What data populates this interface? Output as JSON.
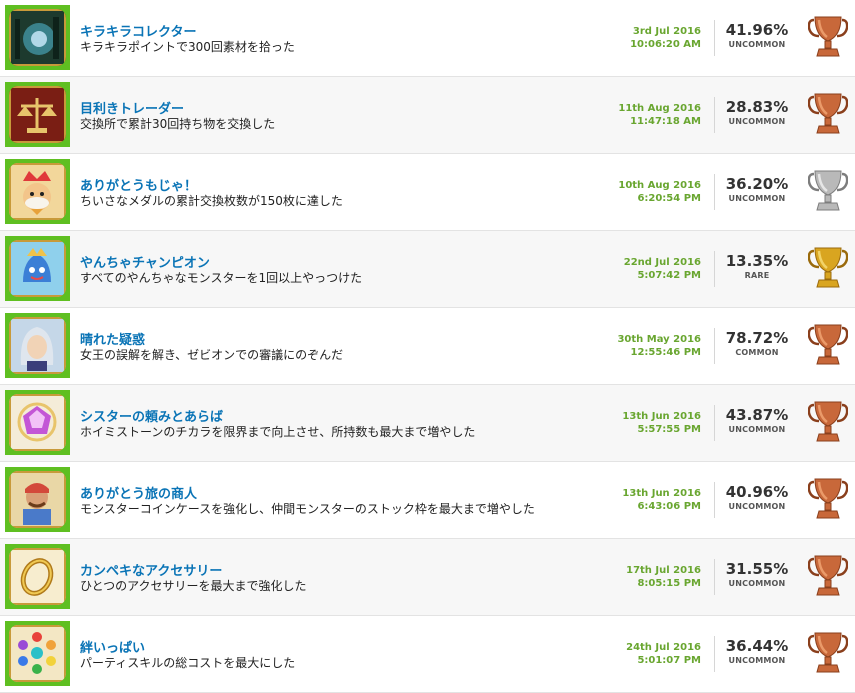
{
  "colors": {
    "accent_green": "#5fbf21",
    "title_blue": "#0a74b6",
    "date_green": "#69a630",
    "bronze": "#c8683a",
    "silver": "#b9b9b9",
    "gold": "#d9a520"
  },
  "trophies": [
    {
      "title": "キラキラコレクター",
      "description": "キラキラポイントで300回素材を拾った",
      "date": "3rd Jul 2016",
      "time": "10:06:20 AM",
      "percent": "41.96%",
      "rarity": "UNCOMMON",
      "trophy_type": "bronze",
      "icon": "glowing-forest-icon"
    },
    {
      "title": "目利きトレーダー",
      "description": "交換所で累計30回持ち物を交換した",
      "date": "11th Aug 2016",
      "time": "11:47:18 AM",
      "percent": "28.83%",
      "rarity": "UNCOMMON",
      "trophy_type": "bronze",
      "icon": "scales-icon"
    },
    {
      "title": "ありがとうもじゃ！",
      "description": "ちいさなメダルの累計交換枚数が150枚に達した",
      "date": "10th Aug 2016",
      "time": "6:20:54 PM",
      "percent": "36.20%",
      "rarity": "UNCOMMON",
      "trophy_type": "silver",
      "icon": "king-character-icon"
    },
    {
      "title": "やんちゃチャンピオン",
      "description": "すべてのやんちゃなモンスターを1回以上やっつけた",
      "date": "22nd Jul 2016",
      "time": "5:07:42 PM",
      "percent": "13.35%",
      "rarity": "RARE",
      "trophy_type": "gold",
      "icon": "slime-monster-icon"
    },
    {
      "title": "晴れた疑惑",
      "description": "女王の誤解を解き、ゼビオンでの審議にのぞんだ",
      "date": "30th May 2016",
      "time": "12:55:46 PM",
      "percent": "78.72%",
      "rarity": "COMMON",
      "trophy_type": "bronze",
      "icon": "silver-hair-character-icon"
    },
    {
      "title": "シスターの頼みとあらば",
      "description": "ホイミストーンのチカラを限界まで向上させ、所持数も最大まで増やした",
      "date": "13th Jun 2016",
      "time": "5:57:55 PM",
      "percent": "43.87%",
      "rarity": "UNCOMMON",
      "trophy_type": "bronze",
      "icon": "healing-gem-icon"
    },
    {
      "title": "ありがとう旅の商人",
      "description": "モンスターコインケースを強化し、仲間モンスターのストック枠を最大まで増やした",
      "date": "13th Jun 2016",
      "time": "6:43:06 PM",
      "percent": "40.96%",
      "rarity": "UNCOMMON",
      "trophy_type": "bronze",
      "icon": "merchant-character-icon"
    },
    {
      "title": "カンペキなアクセサリー",
      "description": "ひとつのアクセサリーを最大まで強化した",
      "date": "17th Jul 2016",
      "time": "8:05:15 PM",
      "percent": "31.55%",
      "rarity": "UNCOMMON",
      "trophy_type": "bronze",
      "icon": "gold-ring-icon"
    },
    {
      "title": "絆いっぱい",
      "description": "パーティスキルの総コストを最大にした",
      "date": "24th Jul 2016",
      "time": "5:01:07 PM",
      "percent": "36.44%",
      "rarity": "UNCOMMON",
      "trophy_type": "bronze",
      "icon": "colored-orbs-icon"
    }
  ]
}
